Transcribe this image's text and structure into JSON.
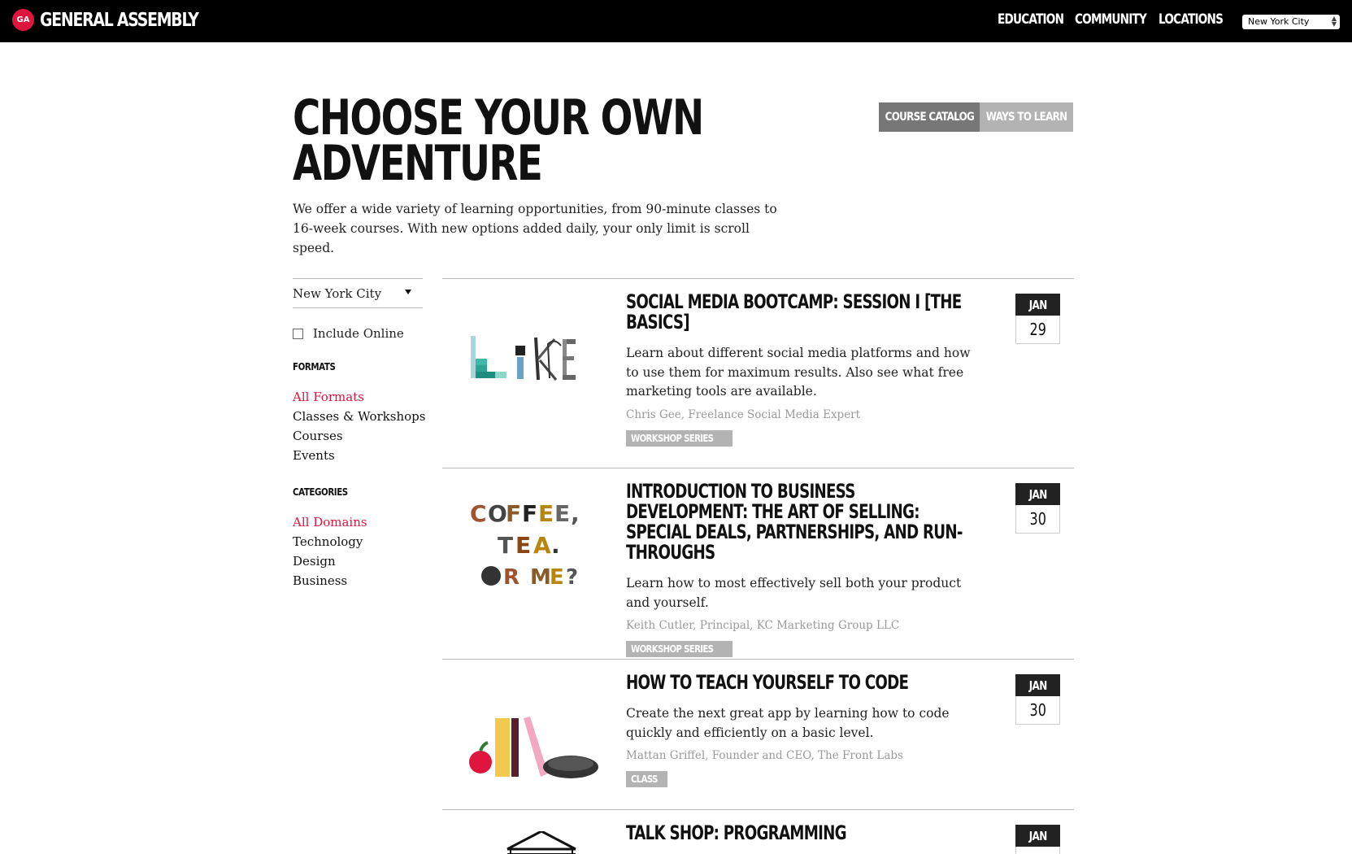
{
  "header": {
    "logo_badge": "GA",
    "logo_text": "GENERAL ASSEMBLY",
    "nav": [
      "EDUCATION",
      "COMMUNITY",
      "LOCATIONS"
    ],
    "city_select": "New York City"
  },
  "hero": {
    "title_line1": "CHOOSE YOUR OWN",
    "title_line2": "ADVENTURE",
    "description": "We offer a wide variety of learning opportunities, from 90-minute classes to 16-week courses. With new options added daily, your only limit is scroll speed.",
    "toggle": {
      "active": "COURSE CATALOG",
      "inactive": "WAYS TO LEARN"
    }
  },
  "sidebar": {
    "location": "New York City",
    "include_online": "Include Online",
    "formats_heading": "FORMATS",
    "formats": [
      "All Formats",
      "Classes & Workshops",
      "Courses",
      "Events"
    ],
    "categories_heading": "CATEGORIES",
    "categories": [
      "All Domains",
      "Technology",
      "Design",
      "Business"
    ]
  },
  "listings": [
    {
      "title": "SOCIAL MEDIA BOOTCAMP: SESSION I [THE BASICS]",
      "description": "Learn about different social media platforms and how to use them for maximum results. Also see what free marketing tools are available.",
      "author": "Chris Gee, Freelance Social Media Expert",
      "tag": "WORKSHOP SERIES",
      "month": "JAN",
      "day": "29",
      "image": "like-letters-image"
    },
    {
      "title": "INTRODUCTION TO BUSINESS DEVELOPMENT: THE ART OF SELLING: SPECIAL DEALS, PARTNERSHIPS, AND RUN-THROUGHS",
      "description": "Learn how to most effectively sell both your product and yourself.",
      "author": "Keith Cutler, Principal, KC Marketing Group LLC",
      "tag": "WORKSHOP SERIES",
      "month": "JAN",
      "day": "30",
      "image": "coffee-tea-or-me-image"
    },
    {
      "title": "HOW TO TEACH YOURSELF TO CODE",
      "description": "Create the next great app by learning how to code quickly and efficiently on a basic level.",
      "author": "Mattan Griffel, Founder and CEO, The Front Labs",
      "tag": "CLASS",
      "month": "JAN",
      "day": "30",
      "image": "books-apple-mouse-image"
    },
    {
      "title": "TALK SHOP: PROGRAMMING",
      "description": "",
      "author": "",
      "tag": "",
      "month": "JAN",
      "day": "",
      "image": "shop-awning-image"
    }
  ],
  "colors": {
    "accent": "#e0153e",
    "topbar": "#000000",
    "toggle_active": "#777777",
    "toggle_inactive": "#b3b3b3"
  }
}
